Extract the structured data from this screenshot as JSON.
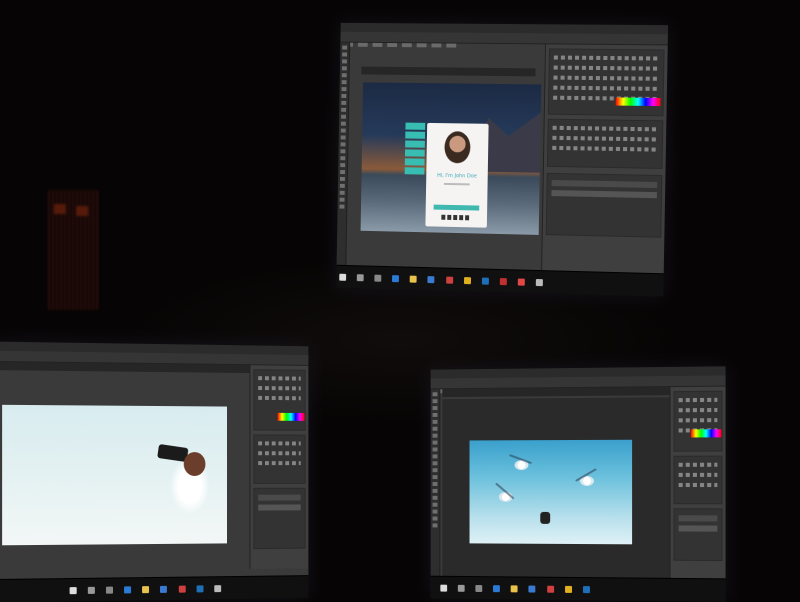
{
  "scene": {
    "description_tags": [
      "three-monitor-setup",
      "image-editor-app"
    ],
    "colors": {
      "room": "#060404",
      "editor_dark": "#3a3a3a",
      "accent_teal": "#3fb8b0",
      "name_blue": "#3aa8b8"
    }
  },
  "monitors": {
    "top": {
      "card": {
        "greeting": "Hi, I'm John Doe"
      },
      "taskbar_icons": [
        "start-icon",
        "search-icon",
        "task-view-icon",
        "edge-icon",
        "explorer-icon",
        "store-icon",
        "app-icon",
        "chrome-icon",
        "photoshop-icon",
        "app-icon",
        "app-icon",
        "app-icon"
      ]
    },
    "left": {
      "taskbar_icons": [
        "start-icon",
        "search-icon",
        "task-view-icon",
        "edge-icon",
        "explorer-icon",
        "store-icon",
        "app-icon",
        "app-icon",
        "app-icon"
      ]
    },
    "right": {
      "taskbar_icons": [
        "start-icon",
        "search-icon",
        "task-view-icon",
        "edge-icon",
        "explorer-icon",
        "store-icon",
        "app-icon",
        "chrome-icon",
        "photoshop-icon"
      ]
    }
  }
}
